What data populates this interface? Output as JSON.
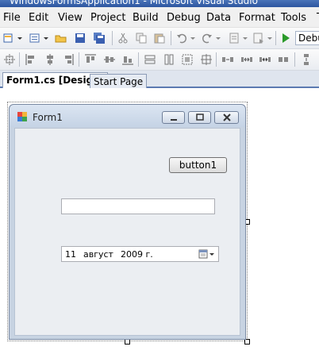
{
  "window": {
    "title": "WindowsFormsApplication1 - Microsoft Visual Studio"
  },
  "menu": {
    "items": [
      "File",
      "Edit",
      "View",
      "Project",
      "Build",
      "Debug",
      "Data",
      "Format",
      "Tools",
      "T"
    ]
  },
  "toolbar": {
    "config_combo": "Debu"
  },
  "tabs": [
    {
      "label": "Form1.cs [Design]",
      "active": true
    },
    {
      "label": "Start Page",
      "active": false
    }
  ],
  "form": {
    "title": "Form1",
    "button1_label": "button1",
    "textbox_value": "",
    "datepicker": {
      "day": "11",
      "month": "август",
      "year": "2009 г."
    }
  },
  "colors": {
    "titlebar": "#2d56a0",
    "tab_border": "#5b7ab1",
    "form_frame": "#c7d3e2",
    "client": "#ebeef2"
  }
}
